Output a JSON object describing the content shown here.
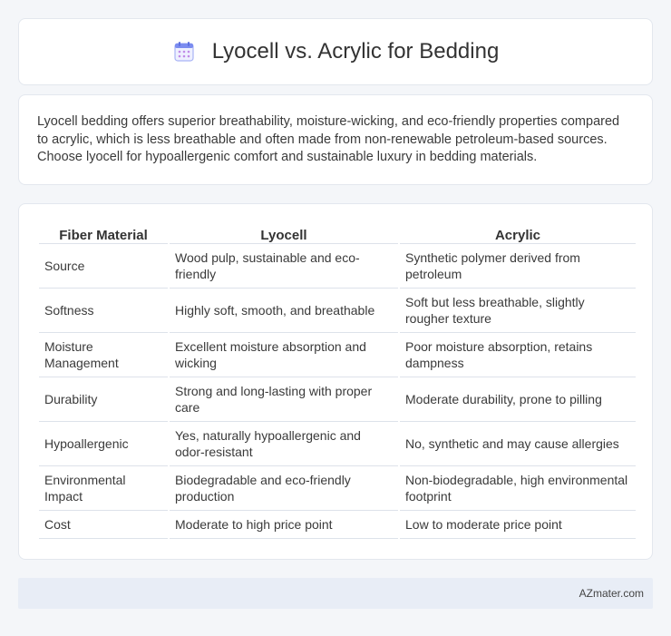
{
  "header": {
    "title": "Lyocell vs. Acrylic for Bedding",
    "icon": "calendar-icon"
  },
  "summary": {
    "text": "Lyocell bedding offers superior breathability, moisture-wicking, and eco-friendly properties compared to acrylic, which is less breathable and often made from non-renewable petroleum-based sources. Choose lyocell for hypoallergenic comfort and sustainable luxury in bedding materials."
  },
  "table": {
    "headers": [
      "Fiber Material",
      "Lyocell",
      "Acrylic"
    ],
    "rows": [
      [
        "Source",
        "Wood pulp, sustainable and eco-friendly",
        "Synthetic polymer derived from petroleum"
      ],
      [
        "Softness",
        "Highly soft, smooth, and breathable",
        "Soft but less breathable, slightly rougher texture"
      ],
      [
        "Moisture Management",
        "Excellent moisture absorption and wicking",
        "Poor moisture absorption, retains dampness"
      ],
      [
        "Durability",
        "Strong and long-lasting with proper care",
        "Moderate durability, prone to pilling"
      ],
      [
        "Hypoallergenic",
        "Yes, naturally hypoallergenic and odor-resistant",
        "No, synthetic and may cause allergies"
      ],
      [
        "Environmental Impact",
        "Biodegradable and eco-friendly production",
        "Non-biodegradable, high environmental footprint"
      ],
      [
        "Cost",
        "Moderate to high price point",
        "Low to moderate price point"
      ]
    ]
  },
  "footer": {
    "text": "AZmater.com"
  },
  "colors": {
    "background": "#f4f6f9",
    "card": "#ffffff",
    "footer": "#e8edf6",
    "icon_accent": "#7b8cf0"
  }
}
